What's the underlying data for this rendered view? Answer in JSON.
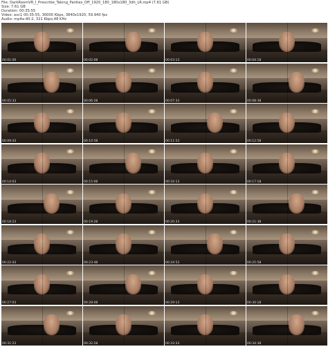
{
  "header": {
    "lines": [
      "File: DarkRoomVR_I_Prescribe_Taking_Panties_Off_1920_180_180x180_3dh_LR.mp4 (7.61 GB)",
      "Size: 7.61 GB",
      "Duration: 00:35:55",
      "Video: avc1 00:35:55, 30000 Kbps, 3840x1920, 59.940 fps",
      "Audio: mp4a-40-2, 321 Kbps,48 KHz"
    ]
  },
  "thumbnails": [
    "00:01:00",
    "00:02:08",
    "00:03:13",
    "00:04:18",
    "00:05:33",
    "00:06:28",
    "00:07:33",
    "00:08:38",
    "00:09:43",
    "00:10:58",
    "00:11:53",
    "00:12:58",
    "00:14:03",
    "00:15:08",
    "00:16:13",
    "00:17:18",
    "00:18:23",
    "00:19:28",
    "00:20:33",
    "00:21:38",
    "00:22:43",
    "00:23:48",
    "00:24:53",
    "00:25:58",
    "00:27:03",
    "00:28:08",
    "00:29:13",
    "00:30:18",
    "00:31:23",
    "00:32:28",
    "00:33:33",
    "00:34:38"
  ]
}
